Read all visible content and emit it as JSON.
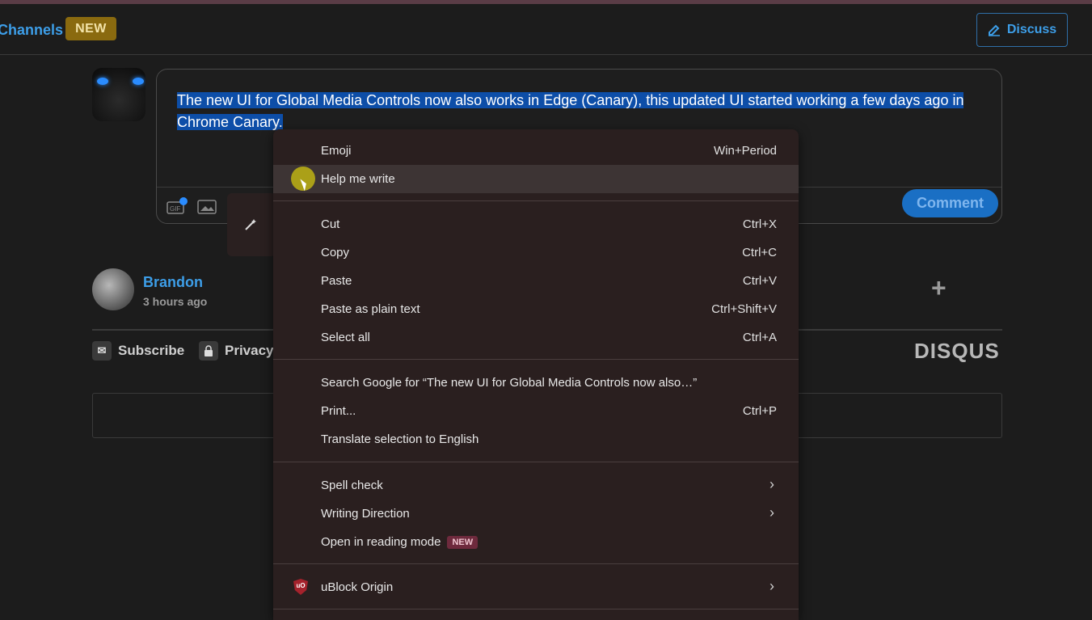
{
  "header": {
    "channels_label": "Channels",
    "new_badge": "NEW",
    "discuss_label": "Discuss"
  },
  "editor": {
    "text": "The new UI for Global Media Controls now also works in Edge (Canary), this updated UI started working a few days ago in Chrome Canary.",
    "gif_label": "GIF",
    "comment_button": "Comment"
  },
  "comment": {
    "username": "Brandon",
    "time": "3 hours ago"
  },
  "footer": {
    "subscribe": "Subscribe",
    "privacy": "Privacy",
    "brand": "DISQUS"
  },
  "context_menu": {
    "items": [
      {
        "label": "Emoji",
        "shortcut": "Win+Period"
      },
      {
        "label": "Help me write",
        "shortcut": ""
      },
      {
        "label": "Cut",
        "shortcut": "Ctrl+X"
      },
      {
        "label": "Copy",
        "shortcut": "Ctrl+C"
      },
      {
        "label": "Paste",
        "shortcut": "Ctrl+V"
      },
      {
        "label": "Paste as plain text",
        "shortcut": "Ctrl+Shift+V"
      },
      {
        "label": "Select all",
        "shortcut": "Ctrl+A"
      },
      {
        "label": "Search Google for “The new UI for Global Media Controls now also…”",
        "shortcut": ""
      },
      {
        "label": "Print...",
        "shortcut": "Ctrl+P"
      },
      {
        "label": "Translate selection to English",
        "shortcut": ""
      },
      {
        "label": "Spell check",
        "shortcut": ""
      },
      {
        "label": "Writing Direction",
        "shortcut": ""
      },
      {
        "label": "Open in reading mode",
        "shortcut": "",
        "badge": "NEW"
      },
      {
        "label": "uBlock Origin",
        "shortcut": ""
      }
    ]
  },
  "colors": {
    "accent": "#3d9ee8",
    "selection": "#0d4ea8",
    "menu_bg": "#2a1f1f",
    "highlight": "#3d3434"
  }
}
